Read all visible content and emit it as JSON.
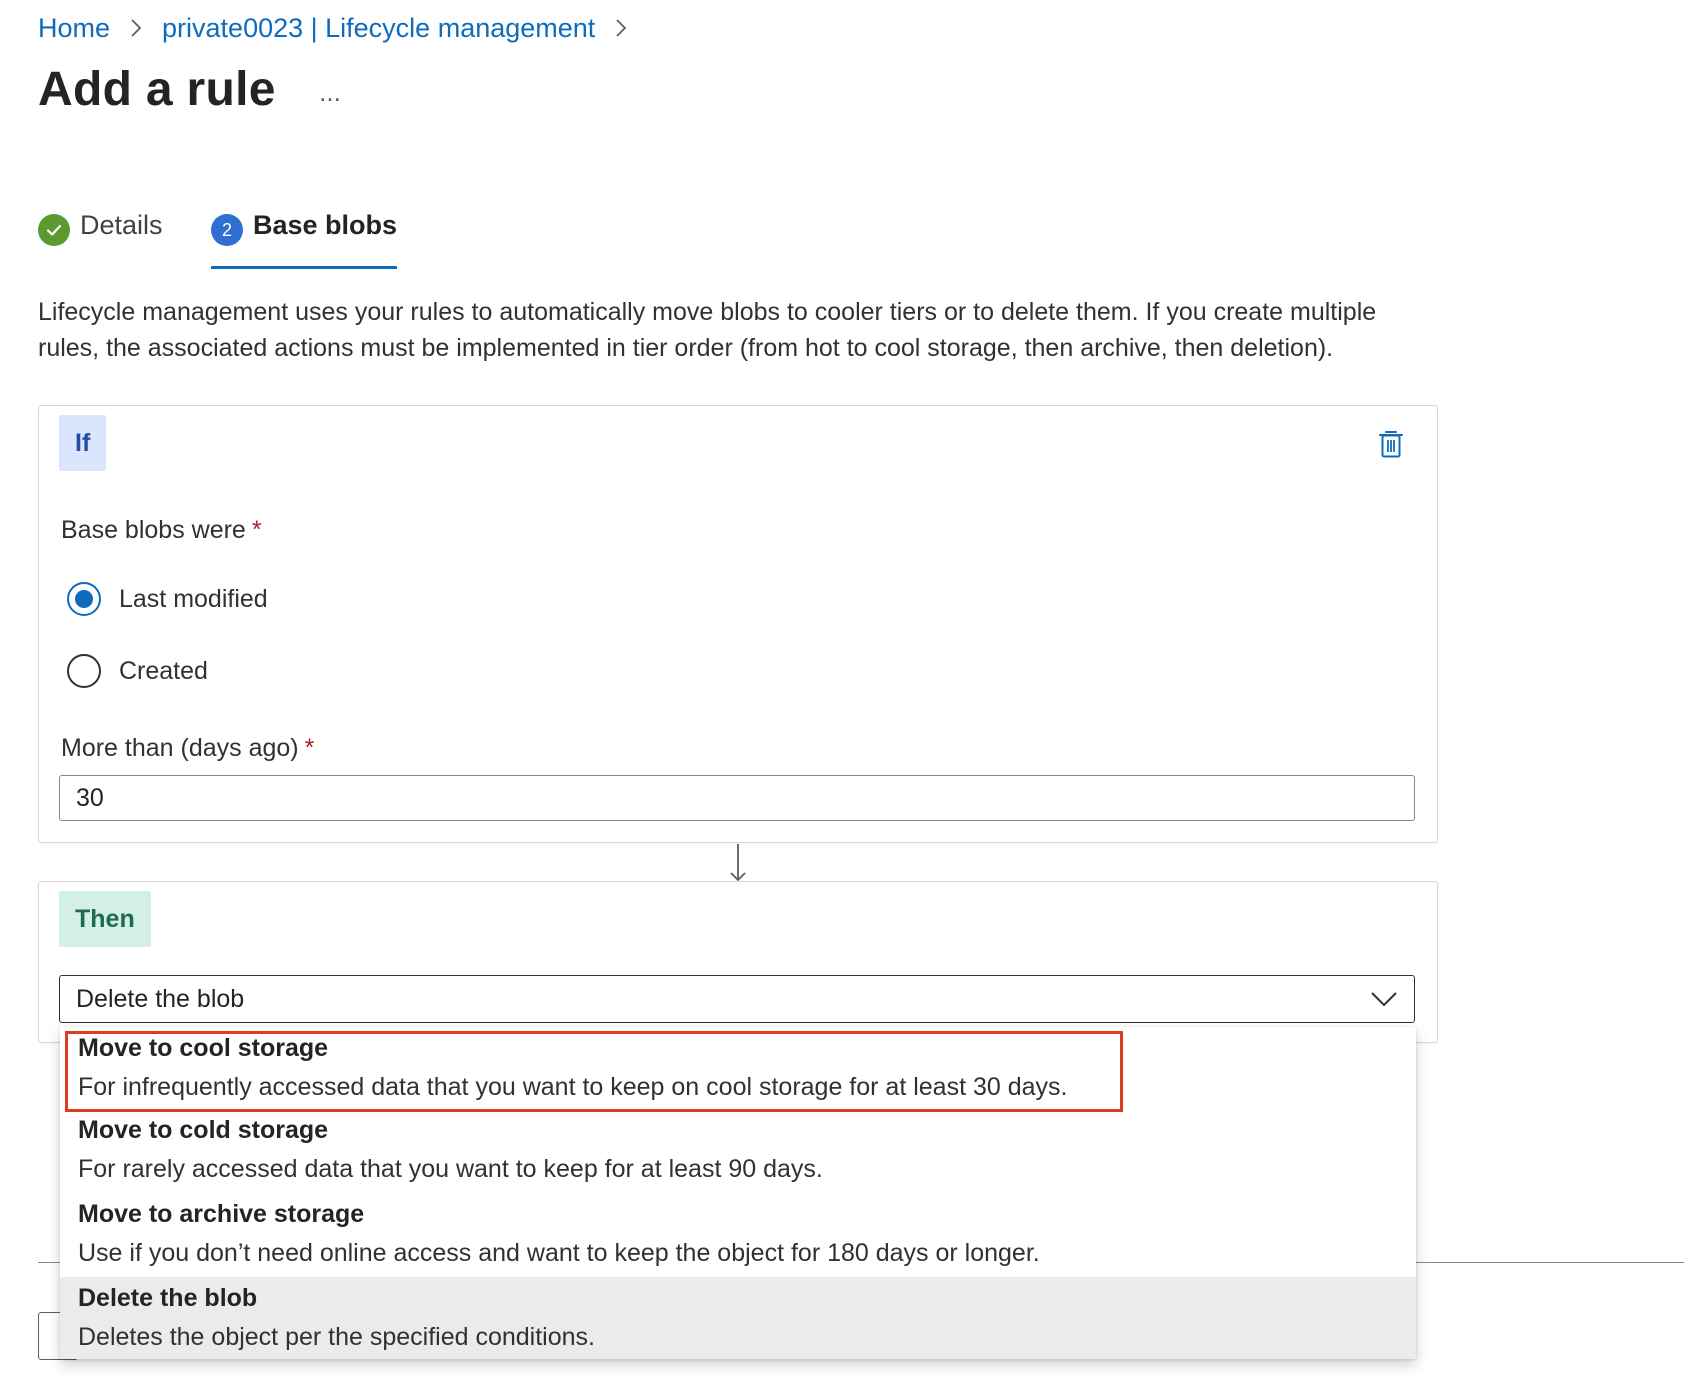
{
  "breadcrumb": {
    "items": [
      "Home",
      "private0023 | Lifecycle management"
    ]
  },
  "page": {
    "title": "Add a rule",
    "more_label": "..."
  },
  "wizard": {
    "tabs": [
      {
        "label": "Details",
        "state": "complete",
        "icon": "checkmark-icon"
      },
      {
        "label": "Base blobs",
        "step": "2",
        "state": "active"
      }
    ]
  },
  "description": "Lifecycle management uses your rules to automatically move blobs to cooler tiers or to delete them. If you create multiple rules, the associated actions must be implemented in tier order (from hot to cool storage, then archive, then deletion).",
  "if_block": {
    "badge": "If",
    "base_blobs_label": "Base blobs were",
    "required_mark": "*",
    "radio_options": [
      {
        "label": "Last modified",
        "checked": true
      },
      {
        "label": "Created",
        "checked": false
      }
    ],
    "days_label": "More than (days ago)",
    "days_value": "30"
  },
  "then_block": {
    "badge": "Then",
    "selected_action": "Delete the blob",
    "options": [
      {
        "title": "Move to cool storage",
        "description": "For infrequently accessed data that you want to keep on cool storage for at least 30 days.",
        "highlighted": true
      },
      {
        "title": "Move to cold storage",
        "description": "For rarely accessed data that you want to keep for at least 90 days."
      },
      {
        "title": "Move to archive storage",
        "description": "Use if you don’t need online access and want to keep the object for 180 days or longer."
      },
      {
        "title": "Delete the blob",
        "description": "Deletes the object per the specified conditions.",
        "selected": true
      }
    ]
  },
  "colors": {
    "accent": "#0f6cbd",
    "highlight_border": "#e03c1f",
    "if_badge_bg": "#dbe5fb",
    "then_badge_bg": "#d4efe7",
    "success": "#5b9a2e"
  }
}
